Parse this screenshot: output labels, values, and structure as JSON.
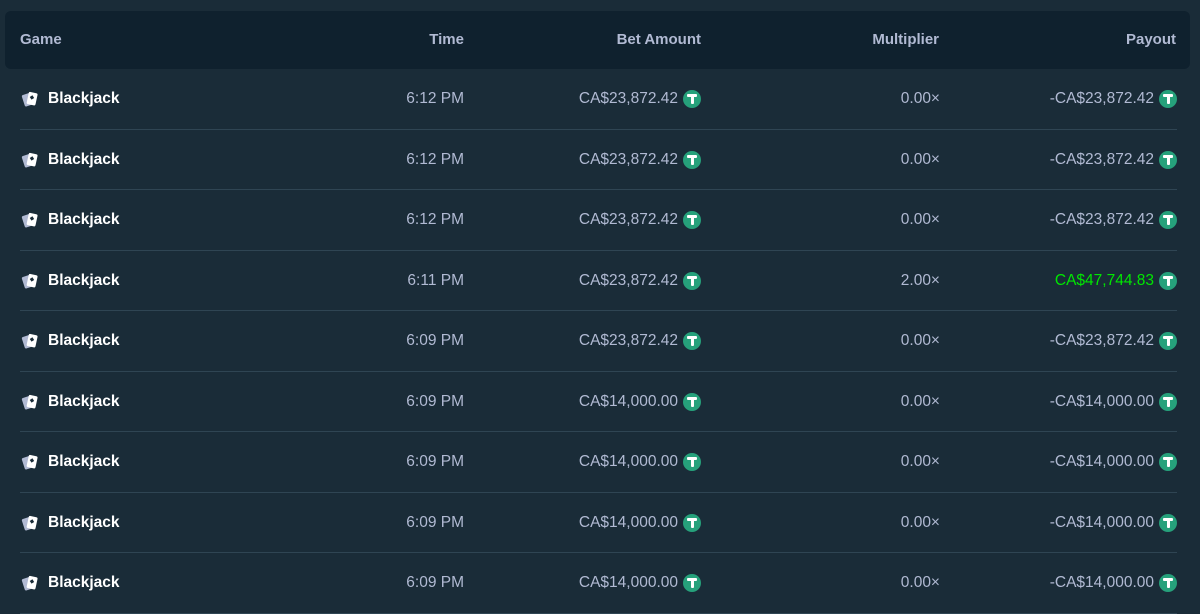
{
  "colors": {
    "background": "#1a2c38",
    "header_background": "#0f212e",
    "divider": "#2f4553",
    "text_muted": "#b1bad3",
    "text_bright": "#ffffff",
    "win": "#00e701",
    "coin": "#26a17b"
  },
  "columns": {
    "game": "Game",
    "time": "Time",
    "bet_amount": "Bet Amount",
    "multiplier": "Multiplier",
    "payout": "Payout"
  },
  "rows": [
    {
      "game": "Blackjack",
      "game_icon": "playing-cards-icon",
      "time": "6:12 PM",
      "bet": "CA$23,872.42",
      "multiplier": "0.00×",
      "payout": "-CA$23,872.42",
      "win": false,
      "currency_icon": "tether-icon"
    },
    {
      "game": "Blackjack",
      "game_icon": "playing-cards-icon",
      "time": "6:12 PM",
      "bet": "CA$23,872.42",
      "multiplier": "0.00×",
      "payout": "-CA$23,872.42",
      "win": false,
      "currency_icon": "tether-icon"
    },
    {
      "game": "Blackjack",
      "game_icon": "playing-cards-icon",
      "time": "6:12 PM",
      "bet": "CA$23,872.42",
      "multiplier": "0.00×",
      "payout": "-CA$23,872.42",
      "win": false,
      "currency_icon": "tether-icon"
    },
    {
      "game": "Blackjack",
      "game_icon": "playing-cards-icon",
      "time": "6:11 PM",
      "bet": "CA$23,872.42",
      "multiplier": "2.00×",
      "payout": "CA$47,744.83",
      "win": true,
      "currency_icon": "tether-icon"
    },
    {
      "game": "Blackjack",
      "game_icon": "playing-cards-icon",
      "time": "6:09 PM",
      "bet": "CA$23,872.42",
      "multiplier": "0.00×",
      "payout": "-CA$23,872.42",
      "win": false,
      "currency_icon": "tether-icon"
    },
    {
      "game": "Blackjack",
      "game_icon": "playing-cards-icon",
      "time": "6:09 PM",
      "bet": "CA$14,000.00",
      "multiplier": "0.00×",
      "payout": "-CA$14,000.00",
      "win": false,
      "currency_icon": "tether-icon"
    },
    {
      "game": "Blackjack",
      "game_icon": "playing-cards-icon",
      "time": "6:09 PM",
      "bet": "CA$14,000.00",
      "multiplier": "0.00×",
      "payout": "-CA$14,000.00",
      "win": false,
      "currency_icon": "tether-icon"
    },
    {
      "game": "Blackjack",
      "game_icon": "playing-cards-icon",
      "time": "6:09 PM",
      "bet": "CA$14,000.00",
      "multiplier": "0.00×",
      "payout": "-CA$14,000.00",
      "win": false,
      "currency_icon": "tether-icon"
    },
    {
      "game": "Blackjack",
      "game_icon": "playing-cards-icon",
      "time": "6:09 PM",
      "bet": "CA$14,000.00",
      "multiplier": "0.00×",
      "payout": "-CA$14,000.00",
      "win": false,
      "currency_icon": "tether-icon"
    }
  ]
}
